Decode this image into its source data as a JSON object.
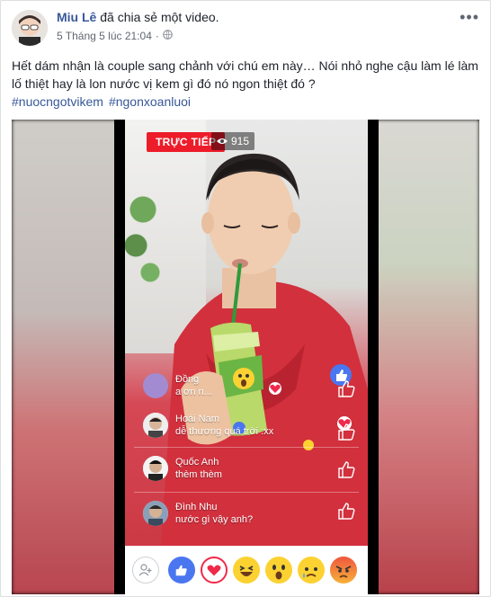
{
  "post": {
    "author_name": "Miu Lê",
    "action": " đã chia sẻ một video.",
    "timestamp": "5 Tháng 5 lúc 21:04",
    "privacy_dot": "·",
    "more_label": "•••",
    "text": "Hết dám nhận là couple sang chảnh với chú em này… Nói nhỏ nghe cậu làm lé làm lố thiệt hay là lon nước vị kem gì đó nó ngon thiệt đó ?",
    "hashtags": [
      "#nuocngotvikem",
      "#ngonxoanluoi"
    ]
  },
  "video": {
    "live_label": "TRỰC TIẾP",
    "viewer_count": "915",
    "comments": [
      {
        "name": "Đồng",
        "text": "a ơn n..."
      },
      {
        "name": "Hoài Nam",
        "text": "dễ thương quá trời :xx"
      },
      {
        "name": "Quốc Anh",
        "text": "thèm thèm"
      },
      {
        "name": "Đình Nhu",
        "text": "nước gì vậy anh?"
      }
    ]
  },
  "colors": {
    "link": "#385898",
    "live_red": "#ed1c2a",
    "like_blue": "#4a76f0",
    "love_red": "#f0284a",
    "haha_yellow": "#fcd232"
  },
  "reactions": [
    "share-icon",
    "like-icon",
    "love-icon",
    "haha-icon",
    "wow-icon",
    "sad-icon",
    "angry-icon"
  ]
}
